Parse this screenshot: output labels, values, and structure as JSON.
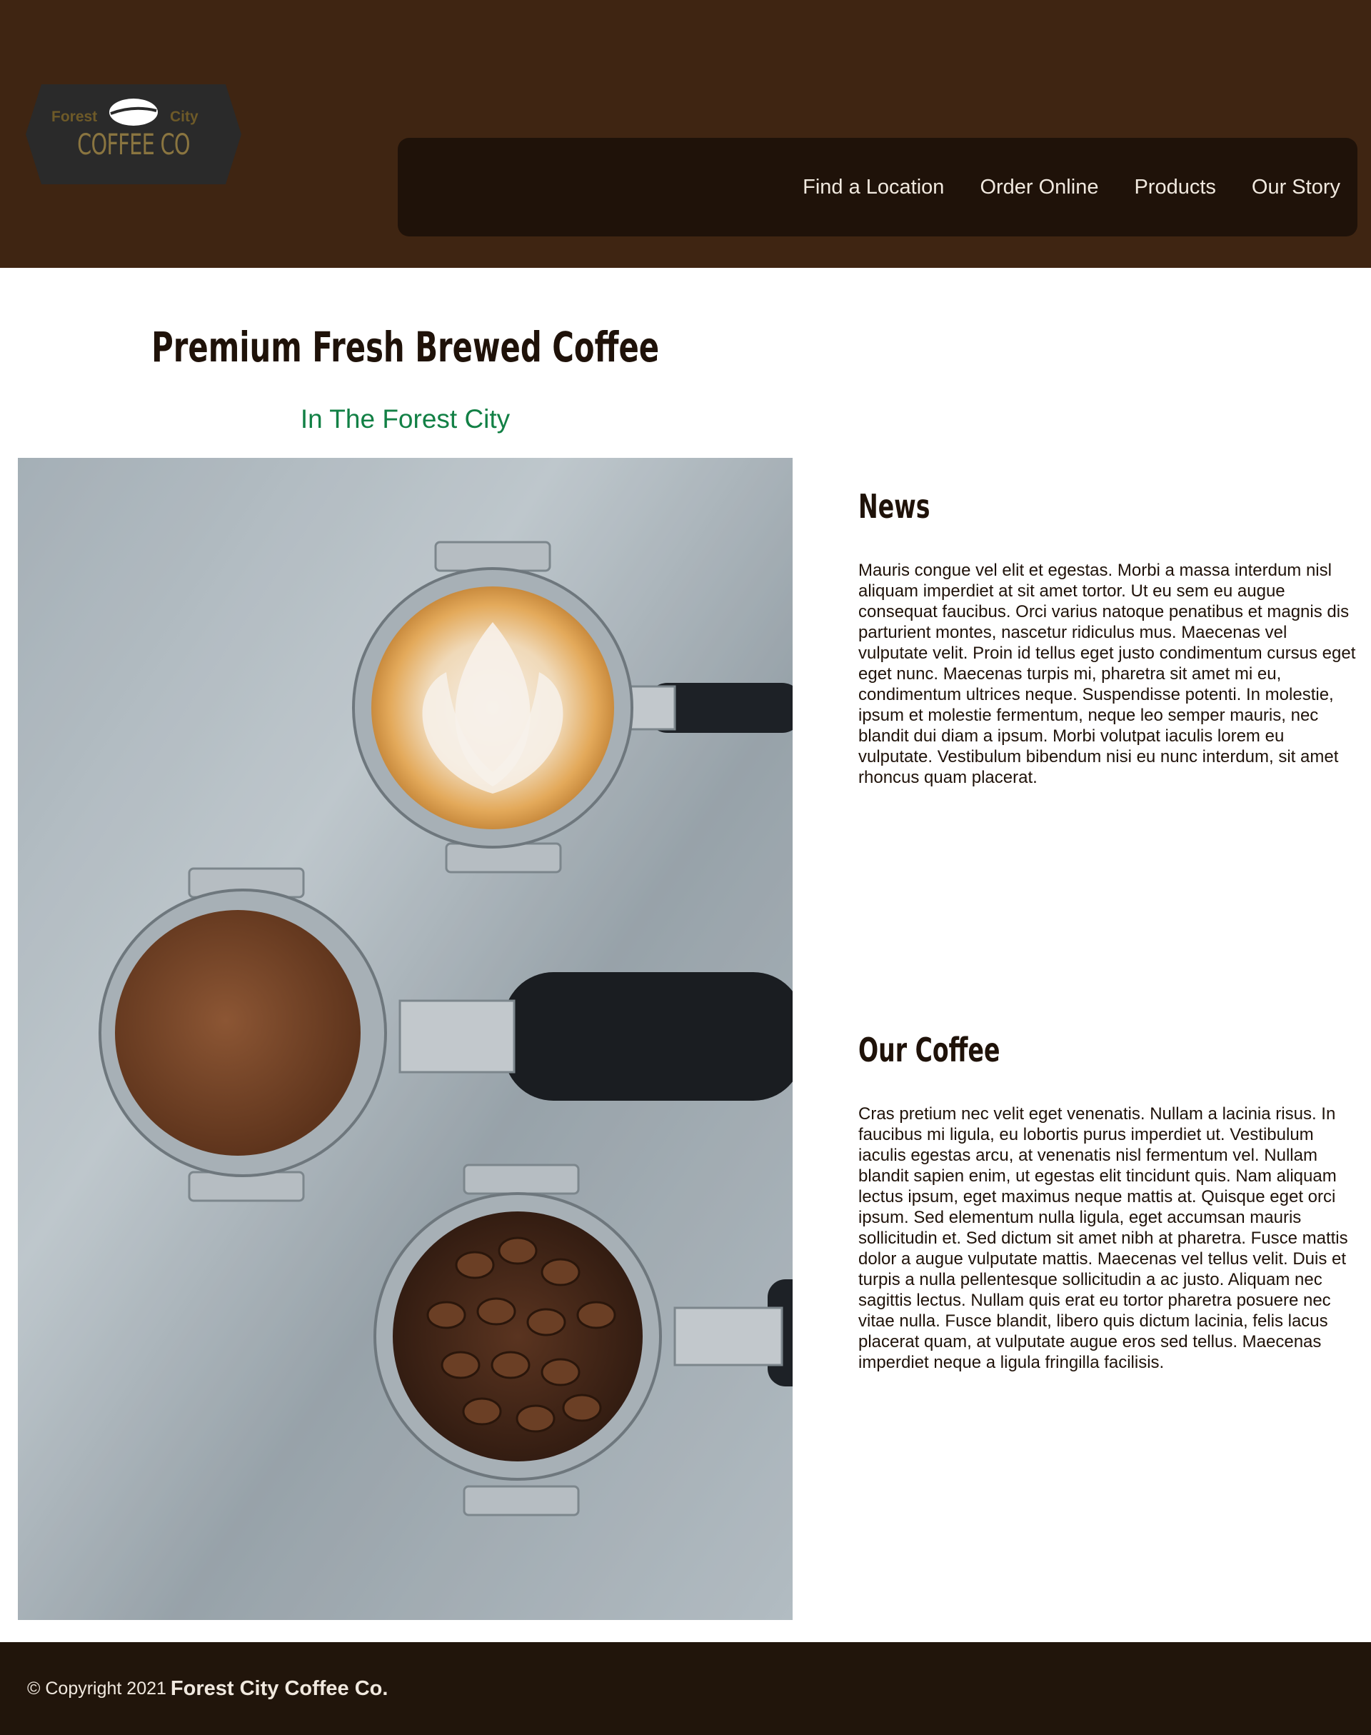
{
  "header": {
    "logo": {
      "word_left": "Forest",
      "word_right": "City",
      "word_bottom": "COFFEE CO"
    },
    "nav": [
      {
        "label": "Find a Location"
      },
      {
        "label": "Order Online"
      },
      {
        "label": "Products"
      },
      {
        "label": "Our Story"
      }
    ]
  },
  "hero": {
    "title": "Premium Fresh Brewed Coffee",
    "subtitle": "In The Forest City"
  },
  "news": {
    "title": "News",
    "body": "Mauris congue vel elit et egestas. Morbi a massa interdum nisl aliquam imperdiet at sit amet tortor. Ut eu sem eu augue consequat faucibus. Orci varius natoque penatibus et magnis dis parturient montes, nascetur ridiculus mus. Maecenas vel vulputate velit. Proin id tellus eget justo condimentum cursus eget eget nunc. Maecenas turpis mi, pharetra sit amet mi eu, condimentum ultrices neque. Suspendisse potenti. In molestie, ipsum et molestie fermentum, neque leo semper mauris, nec blandit dui diam a ipsum. Morbi volutpat iaculis lorem eu vulputate. Vestibulum bibendum nisi eu nunc interdum, sit amet rhoncus quam placerat."
  },
  "our_coffee": {
    "title": "Our Coffee",
    "body": "Cras pretium nec velit eget venenatis. Nullam a lacinia risus. In faucibus mi ligula, eu lobortis purus imperdiet ut. Vestibulum iaculis egestas arcu, at venenatis nisl fermentum vel. Nullam blandit sapien enim, ut egestas elit tincidunt quis. Nam aliquam lectus ipsum, eget maximus neque mattis at. Quisque eget orci ipsum. Sed elementum nulla ligula, eget accumsan mauris sollicitudin et. Sed dictum sit amet nibh at pharetra. Fusce mattis dolor a augue vulputate mattis. Maecenas vel tellus velit. Duis et turpis a nulla pellentesque sollicitudin a ac justo. Aliquam nec sagittis lectus. Nullam quis erat eu tortor pharetra posuere nec vitae nulla. Fusce blandit, libero quis dictum lacinia, felis lacus placerat quam, at vulputate augue eros sed tellus. Maecenas imperdiet neque a ligula fringilla facilisis."
  },
  "footer": {
    "copyright": "© Copyright 2021",
    "brand": "Forest City Coffee Co."
  },
  "colors": {
    "header_bg": "#3f2512",
    "nav_bg": "#1f1209",
    "footer_bg": "#21150b",
    "subtitle_green": "#128045",
    "text_dark": "#1f1209"
  }
}
